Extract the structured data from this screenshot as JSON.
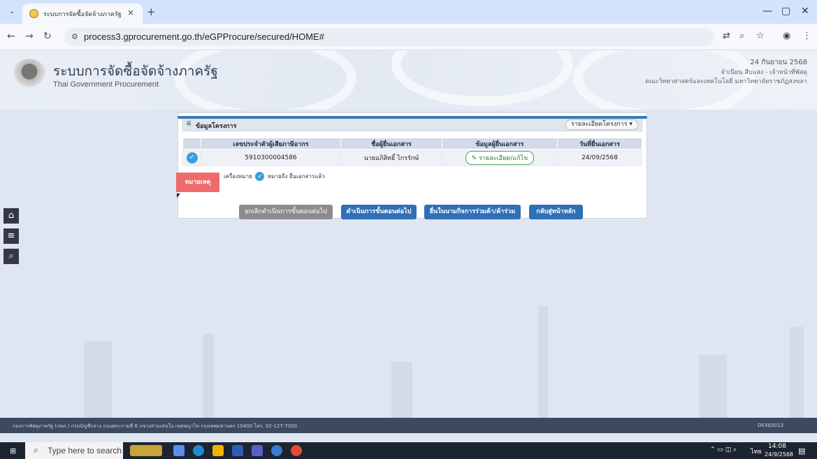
{
  "browser": {
    "tab_title": "ระบบการจัดซื้อจัดจ้างภาครัฐ",
    "url": "process3.gprocurement.go.th/eGPProcure/secured/HOME#"
  },
  "header": {
    "title_th": "ระบบการจัดซื้อจัดจ้างภาครัฐ",
    "title_en": "Thai Government Procurement",
    "date": "24 กันยายน 2568",
    "user": "จำเนียน สืบแสง - เจ้าหน้าที่พัสดุ",
    "org": "คณะวิทยาศาสตร์และเทคโนโลยี มหาวิทยาลัยราชภัฏสงขลา"
  },
  "panel": {
    "title": "ข้อมูลโครงการ",
    "dropdown_label": "รายละเอียดโครงการ",
    "columns": [
      "",
      "เลขประจำตัวผู้เสียภาษีอากร",
      "ชื่อผู้ยื่นเอกสาร",
      "ข้อมูลผู้ยื่นเอกสาร",
      "วันที่ยื่นเอกสาร"
    ],
    "rows": [
      {
        "tax_id": "5910300004586",
        "name": "นายอภิสิทธิ์ ไกรรักษ์",
        "detail_label": "รายละเอียด/แก้ไข",
        "date": "24/09/2568"
      }
    ],
    "note_label": "หมายเหตุ",
    "legend_prefix": "เครื่องหมาย",
    "legend_suffix": "หมายถึง ยื่นเอกสารแล้ว"
  },
  "actions": {
    "cancel": "ยกเลิกดำเนินการขั้นตอนต่อไป",
    "next": "ดำเนินการขั้นตอนต่อไป",
    "joint": "ยื่นในนามกิจการร่วมค้า/ค้าร่วม",
    "home": "กลับสู่หน้าหลัก"
  },
  "footer": {
    "address": "กองการพัสดุภาครัฐ (กพภ.) กรมบัญชีกลาง ถนนพระรามที่ 6 แขวงสามเสนใน เขตพญาไท กรุงเทพมหานคร 10400 โทร. 02-127-7000",
    "code": "DEXE0013"
  },
  "taskbar": {
    "search_placeholder": "Type here to search",
    "lang": "ไทย",
    "time": "14:08",
    "date": "24/9/2568"
  },
  "colors": {
    "accent": "#3a79b8",
    "check": "#3b9ddd",
    "note": "#ef6b6b",
    "btn_primary": "#2f6fb5",
    "btn_disabled": "#8c8c8c"
  }
}
